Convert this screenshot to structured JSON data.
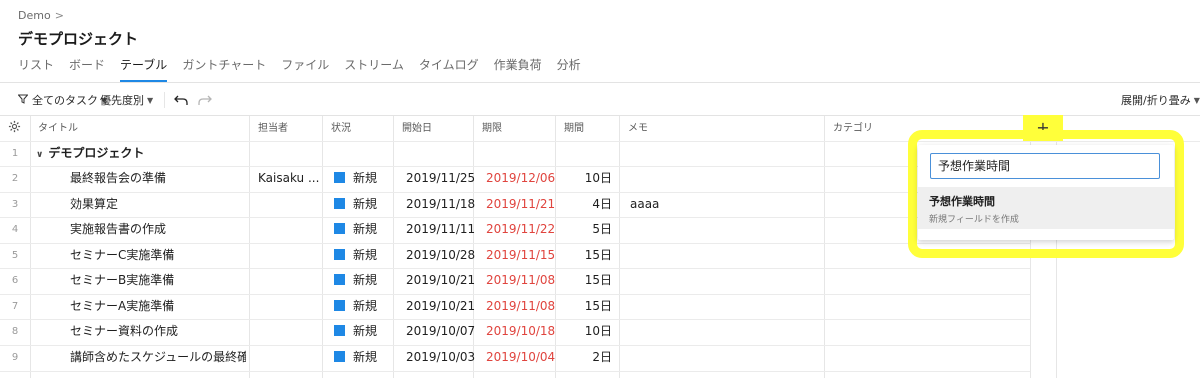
{
  "breadcrumb": {
    "label": "Demo",
    "separator": ">"
  },
  "page_title": "デモプロジェクト",
  "tabs": [
    "リスト",
    "ボード",
    "テーブル",
    "ガントチャート",
    "ファイル",
    "ストリーム",
    "タイムログ",
    "作業負荷",
    "分析"
  ],
  "active_tab": "テーブル",
  "toolbar": {
    "filter_label": "全てのタスク",
    "sort_label": "優先度別",
    "expand_label": "展開/折り畳み"
  },
  "columns": {
    "title": "タイトル",
    "assignee": "担当者",
    "status": "状況",
    "start": "開始日",
    "due": "期限",
    "duration": "期間",
    "memo": "メモ",
    "category": "カテゴリ",
    "add": "+"
  },
  "group": {
    "num": "1",
    "name": "デモプロジェクト"
  },
  "rows": [
    {
      "num": "2",
      "title": "最終報告会の準備",
      "assignee": "Kaisaku ...",
      "status": "新規",
      "start": "2019/11/25",
      "due": "2019/12/06",
      "duration": "10日",
      "memo": ""
    },
    {
      "num": "3",
      "title": "効果算定",
      "assignee": "",
      "status": "新規",
      "start": "2019/11/18",
      "due": "2019/11/21",
      "duration": "4日",
      "memo": "aaaa"
    },
    {
      "num": "4",
      "title": "実施報告書の作成",
      "assignee": "",
      "status": "新規",
      "start": "2019/11/11",
      "due": "2019/11/22",
      "duration": "5日",
      "memo": ""
    },
    {
      "num": "5",
      "title": "セミナーC実施準備",
      "assignee": "",
      "status": "新規",
      "start": "2019/10/28",
      "due": "2019/11/15",
      "duration": "15日",
      "memo": ""
    },
    {
      "num": "6",
      "title": "セミナーB実施準備",
      "assignee": "",
      "status": "新規",
      "start": "2019/10/21",
      "due": "2019/11/08",
      "duration": "15日",
      "memo": ""
    },
    {
      "num": "7",
      "title": "セミナーA実施準備",
      "assignee": "",
      "status": "新規",
      "start": "2019/10/21",
      "due": "2019/11/08",
      "duration": "15日",
      "memo": ""
    },
    {
      "num": "8",
      "title": "セミナー資料の作成",
      "assignee": "",
      "status": "新規",
      "start": "2019/10/07",
      "due": "2019/10/18",
      "duration": "10日",
      "memo": ""
    },
    {
      "num": "9",
      "title": "講師含めたスケジュールの最終確定",
      "assignee": "",
      "status": "新規",
      "start": "2019/10/03",
      "due": "2019/10/04",
      "duration": "2日",
      "memo": ""
    }
  ],
  "popup": {
    "input_value": "予想作業時間",
    "option_title": "予想作業時間",
    "option_subtitle": "新規フィールドを作成"
  },
  "colors": {
    "accent": "#1e88e5",
    "overdue": "#e0443e",
    "highlight": "#ffff3a"
  }
}
